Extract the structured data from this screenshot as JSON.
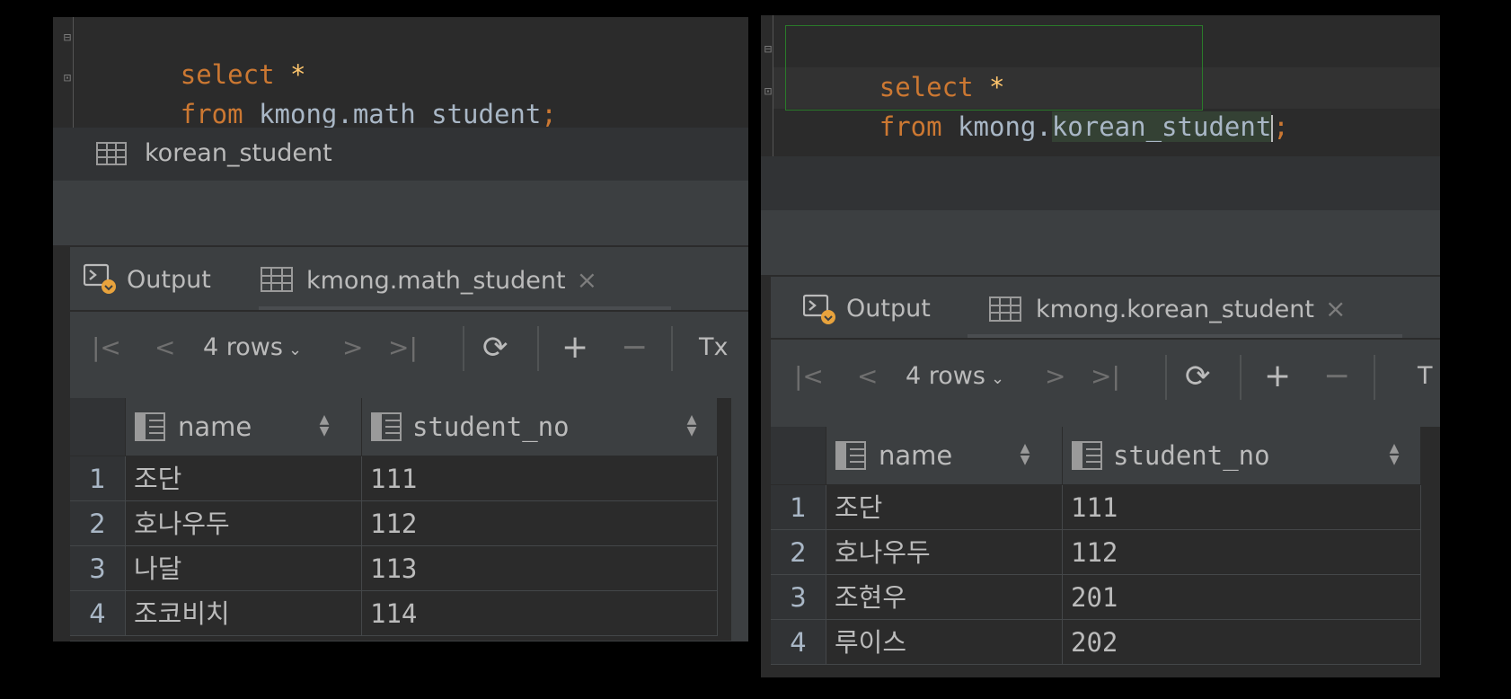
{
  "left_panel": {
    "query": {
      "keyword_select": "select",
      "star": "*",
      "keyword_from": "from",
      "table_ref": "kmong.math_student",
      "semicolon": ";"
    },
    "console_tab": "korean_student",
    "result_tabs": {
      "output_label": "Output",
      "table_tab_label": "kmong.math_student",
      "close": "×"
    },
    "toolbar": {
      "rows_label": "4 rows",
      "first": "|<",
      "prev": "<",
      "next": ">",
      "last": ">|",
      "refresh": "⟳",
      "add": "+",
      "remove": "−",
      "tx": "Tx"
    },
    "columns": [
      "name",
      "student_no"
    ],
    "rows": [
      {
        "no": "1",
        "name": "조단",
        "student_no": "111"
      },
      {
        "no": "2",
        "name": "호나우두",
        "student_no": "112"
      },
      {
        "no": "3",
        "name": "나달",
        "student_no": "113"
      },
      {
        "no": "4",
        "name": "조코비치",
        "student_no": "114"
      }
    ]
  },
  "right_panel": {
    "query": {
      "keyword_select": "select",
      "star": "*",
      "keyword_from": "from",
      "schema_ref": "kmong.",
      "table_ref": "korean_student",
      "semicolon": ";"
    },
    "result_tabs": {
      "output_label": "Output",
      "table_tab_label": "kmong.korean_student",
      "close": "×"
    },
    "toolbar": {
      "rows_label": "4 rows",
      "first": "|<",
      "prev": "<",
      "next": ">",
      "last": ">|",
      "refresh": "⟳",
      "add": "+",
      "remove": "−",
      "tx": "T"
    },
    "columns": [
      "name",
      "student_no"
    ],
    "rows": [
      {
        "no": "1",
        "name": "조단",
        "student_no": "111"
      },
      {
        "no": "2",
        "name": "호나우두",
        "student_no": "112"
      },
      {
        "no": "3",
        "name": "조현우",
        "student_no": "201"
      },
      {
        "no": "4",
        "name": "루이스",
        "student_no": "202"
      }
    ]
  },
  "colors": {
    "background": "#000000",
    "editor_bg": "#2b2b2b",
    "keyword": "#cc7832",
    "identifier": "#a9b7c6",
    "star": "#ffc66d",
    "panel_bg": "#3c3f41",
    "selection_border": "#2a7a2a"
  },
  "icons": {
    "table": "table-grid-icon",
    "column": "column-icon",
    "output": "console-output-icon",
    "sort": "sort-arrows-icon"
  }
}
